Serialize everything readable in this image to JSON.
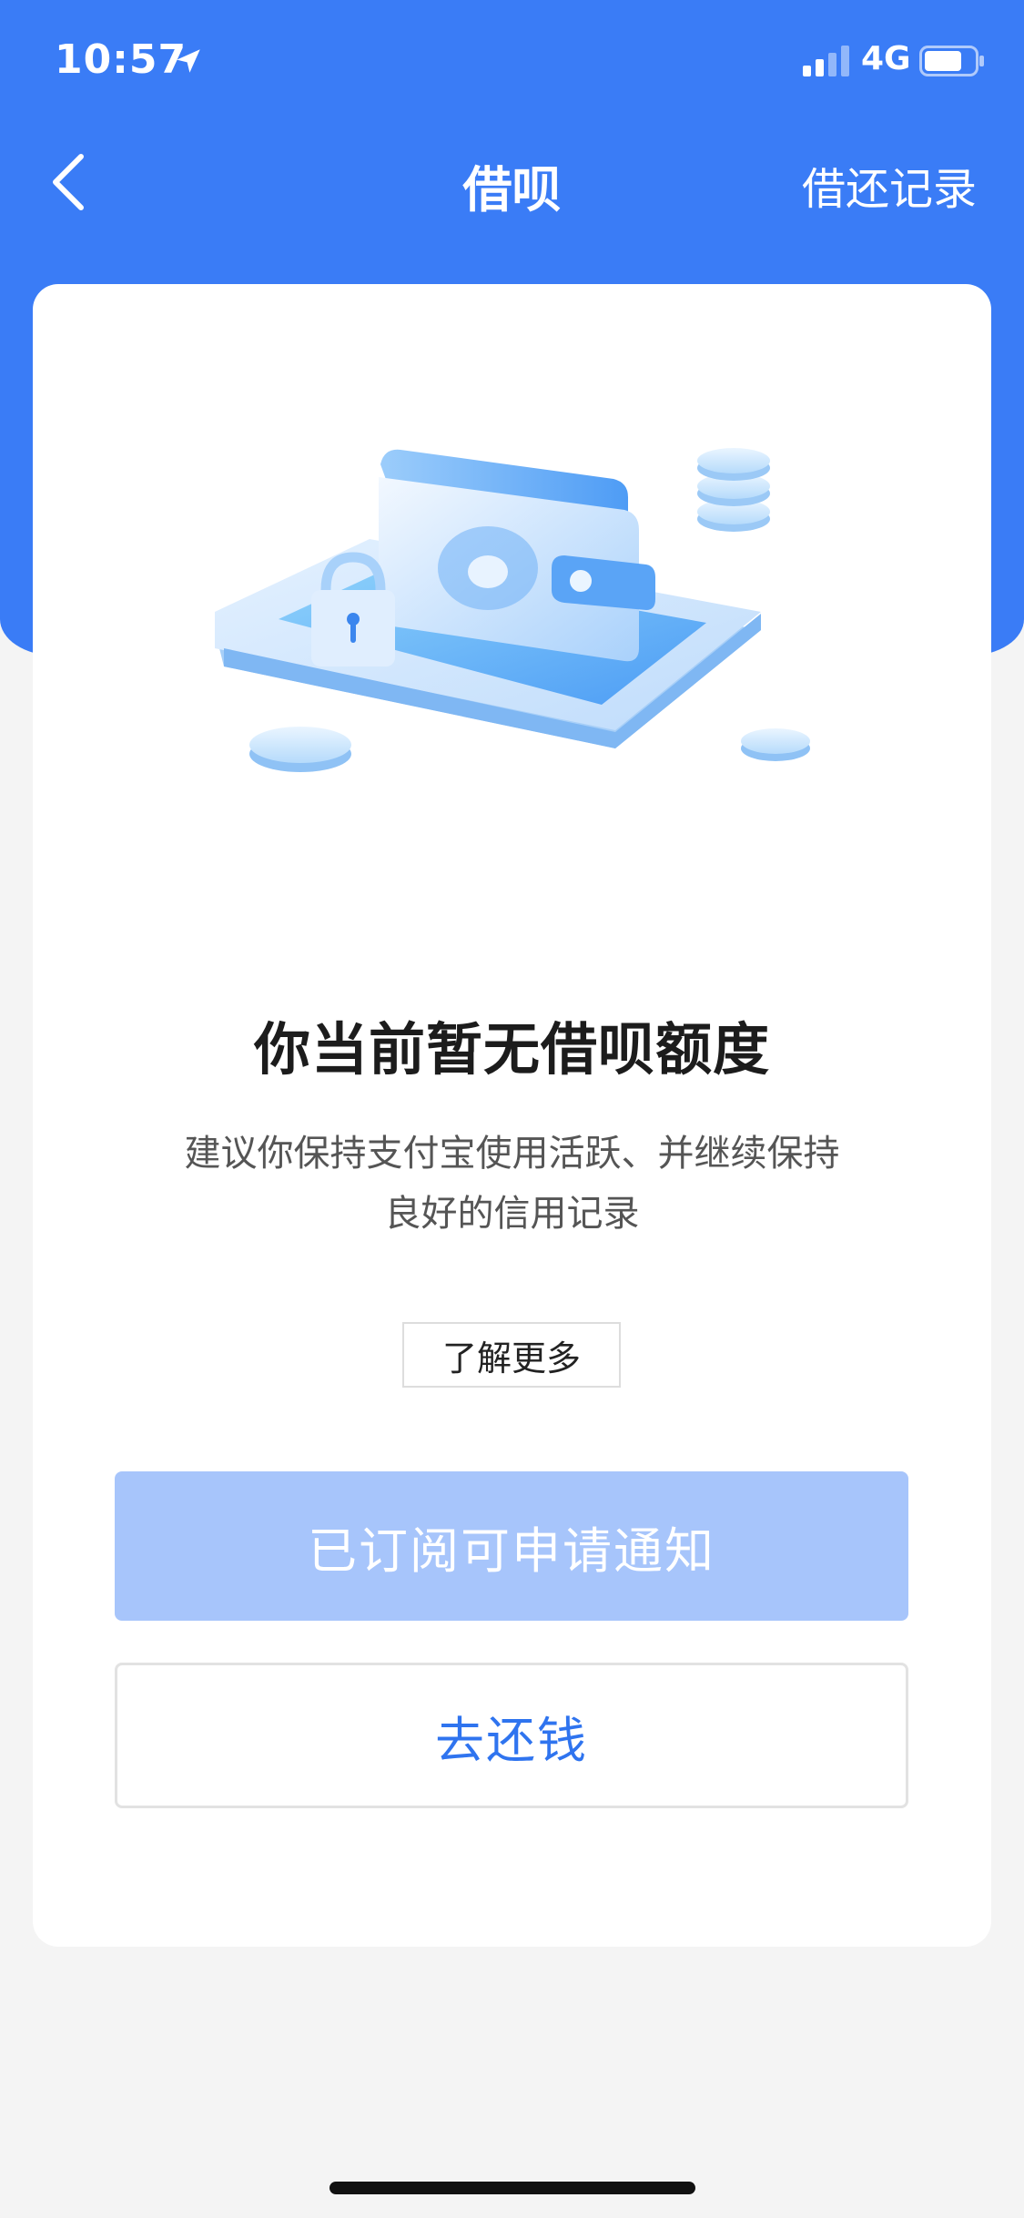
{
  "status_bar": {
    "time": "10:57",
    "network": "4G",
    "icons": [
      "location-arrow-icon",
      "signal-bars-icon",
      "battery-icon"
    ]
  },
  "nav": {
    "title": "借呗",
    "right_action": "借还记录",
    "back_icon": "chevron-left-icon"
  },
  "empty_state": {
    "illustration": "wallet-on-tablet-with-lock-and-coins",
    "headline": "你当前暂无借呗额度",
    "description_line1": "建议你保持支付宝使用活跃、并继续保持",
    "description_line2": "良好的信用记录",
    "learn_more_label": "了解更多"
  },
  "actions": {
    "subscribe_label": "已订阅可申请通知",
    "repay_label": "去还钱"
  },
  "colors": {
    "brand_blue": "#3a7cf6",
    "disabled_button": "#a7c5fb",
    "link_blue": "#2f74ef",
    "background": "#f4f4f4"
  }
}
